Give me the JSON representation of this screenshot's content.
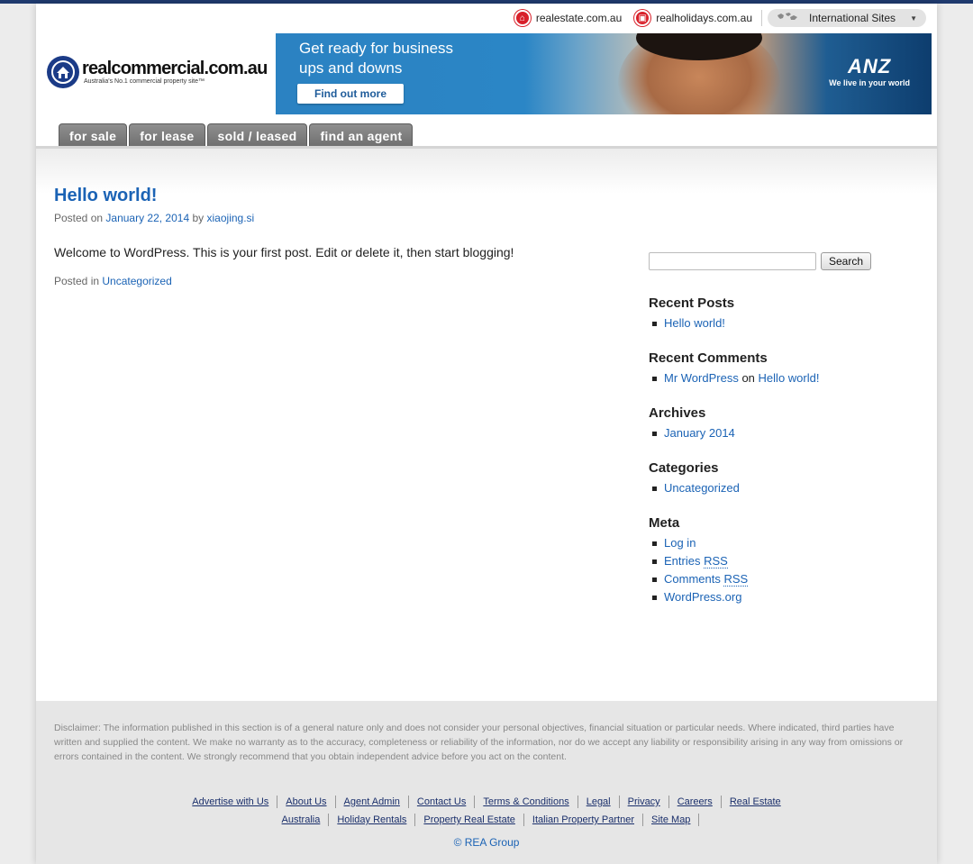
{
  "header": {
    "site_links": [
      {
        "label": "realestate.com.au",
        "icon": "house-icon"
      },
      {
        "label": "realholidays.com.au",
        "icon": "suitcase-icon"
      }
    ],
    "international": {
      "label": "International Sites",
      "icon": "world-map-icon"
    },
    "logo": {
      "name": "realcommercial.com.au",
      "tagline": "Australia's No.1 commercial property site™"
    },
    "banner": {
      "headline": "Get ready for business ups and downs",
      "button": "Find out more",
      "brand": "ANZ",
      "slogan": "We live in your world"
    },
    "tabs": [
      "for sale",
      "for lease",
      "sold / leased",
      "find an agent"
    ]
  },
  "post": {
    "title": "Hello world!",
    "meta_prefix": "Posted on",
    "date": "January 22, 2014",
    "meta_by": "by",
    "author": "xiaojing.si",
    "body": "Welcome to WordPress. This is your first post. Edit or delete it, then start blogging!",
    "category_prefix": "Posted in",
    "category": "Uncategorized"
  },
  "sidebar": {
    "search_value": "",
    "search_button": "Search",
    "recent_posts": {
      "title": "Recent Posts",
      "items": [
        "Hello world!"
      ]
    },
    "recent_comments": {
      "title": "Recent Comments",
      "author": "Mr WordPress",
      "on": "on",
      "post": "Hello world!"
    },
    "archives": {
      "title": "Archives",
      "items": [
        "January 2014"
      ]
    },
    "categories": {
      "title": "Categories",
      "items": [
        "Uncategorized"
      ]
    },
    "meta": {
      "title": "Meta",
      "login": "Log in",
      "entries": "Entries",
      "comments": "Comments",
      "rss": "RSS",
      "wordpress": "WordPress.org"
    }
  },
  "footer": {
    "disclaimer": "Disclaimer: The information published in this section is of a general nature only and does not consider your personal objectives, financial situation or particular needs. Where indicated, third parties have written and supplied the content. We make no warranty as to the accuracy, completeness or reliability of the information, nor do we accept any liability or responsibility arising in any way from omissions or errors contained in the content. We strongly recommend that you obtain independent advice before you act on the content.",
    "links_row1": [
      "Advertise with Us",
      "About Us",
      "Agent Admin",
      "Contact Us",
      "Terms & Conditions",
      "Legal",
      "Privacy",
      "Careers",
      "Real Estate"
    ],
    "links_row2": [
      "Australia",
      "Holiday Rentals",
      "Property Real Estate",
      "Italian Property Partner",
      "Site Map"
    ],
    "copyright": "© REA Group"
  }
}
